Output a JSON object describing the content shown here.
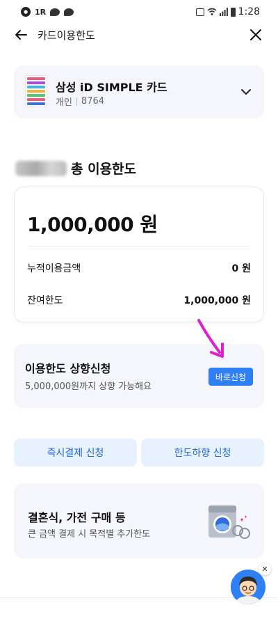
{
  "status_bar": {
    "time": "1:28",
    "left_badge": "1R",
    "icons": [
      "notification-icon",
      "alarm-icon",
      "wifi-icon",
      "signal-icon",
      "battery-icon"
    ]
  },
  "header": {
    "title": "카드이용한도",
    "back_icon": "arrow-left-icon",
    "close_icon": "close-icon"
  },
  "card": {
    "name": "삼성 iD SIMPLE 카드",
    "type": "개인",
    "last4": "8764"
  },
  "limit": {
    "heading_suffix": "총 이용한도",
    "total": "1,000,000 원",
    "rows": [
      {
        "label": "누적이용금액",
        "value": "0 원"
      },
      {
        "label": "잔여한도",
        "value": "1,000,000 원"
      }
    ]
  },
  "raise": {
    "title": "이용한도 상향신청",
    "subtitle": "5,000,000원까지 상향 가능해요",
    "button": "바로신청"
  },
  "actions": {
    "instant_pay": "즉시결제 신청",
    "lower_limit": "한도하향 신청"
  },
  "promo": {
    "title": "결혼식, 가전 구매 등",
    "subtitle": "큰 금액 결제 시 목적별 추가한도"
  },
  "colors": {
    "accent": "#2f7ff5",
    "soft_button_bg": "#e8f1fe",
    "soft_button_text": "#2069d8",
    "panel_bg": "#f4f6fb",
    "annotation_arrow": "#e020d0"
  }
}
